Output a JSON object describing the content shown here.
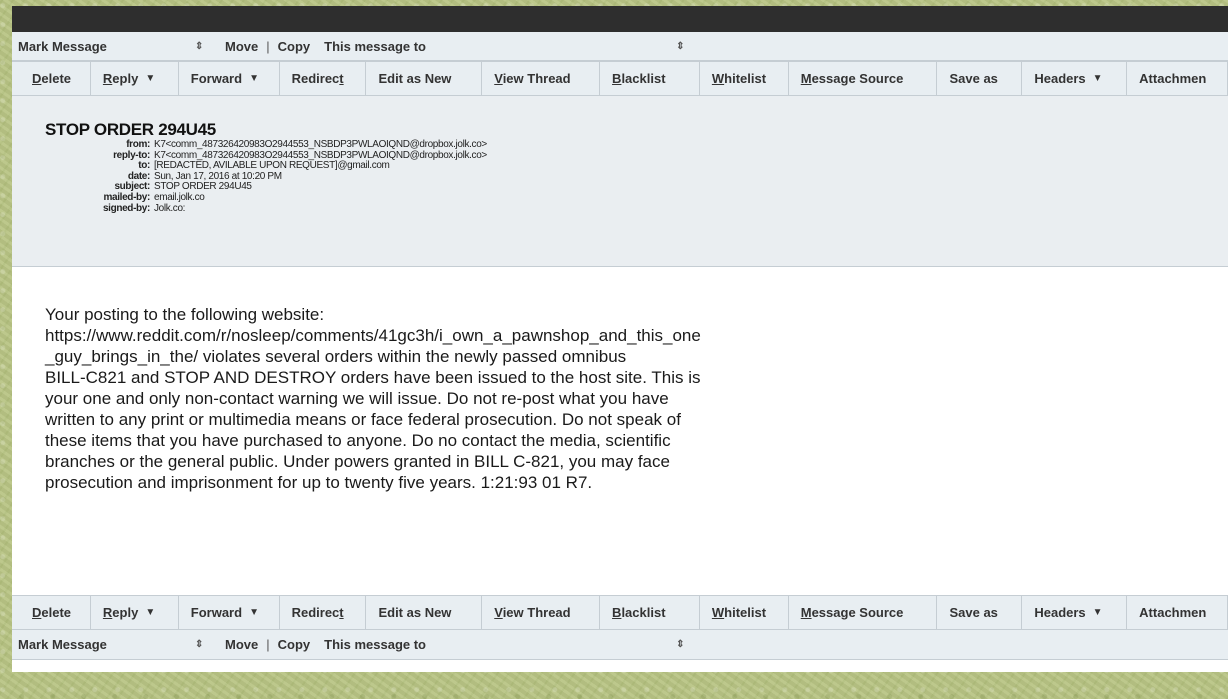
{
  "mark_bar": {
    "mark_message": "Mark Message",
    "move": "Move",
    "separator": "|",
    "copy": "Copy",
    "this_message_to": "This message to"
  },
  "actions": [
    {
      "label": "Delete",
      "mnemonic": "D"
    },
    {
      "label": "Reply",
      "mnemonic": "R",
      "dropdown": true
    },
    {
      "label": "Forward",
      "dropdown": true
    },
    {
      "label": "Redirect",
      "mnemonic": "t"
    },
    {
      "label": "Edit as New"
    },
    {
      "label": "View Thread",
      "mnemonic": "V"
    },
    {
      "label": "Blacklist",
      "mnemonic": "B"
    },
    {
      "label": "Whitelist",
      "mnemonic": "W"
    },
    {
      "label": "Message Source",
      "mnemonic": "M"
    },
    {
      "label": "Save as"
    },
    {
      "label": "Headers",
      "dropdown": true
    },
    {
      "label": "Attachmen"
    }
  ],
  "message": {
    "title": "STOP ORDER 294U45",
    "headers": {
      "from_label": "from:",
      "from": "K7<comm_487326420983O2944553_NSBDP3PWLAOIQND@dropbox.jolk.co>",
      "reply_to_label": "reply-to:",
      "reply_to": "K7<comm_487326420983O2944553_NSBDP3PWLAOIQND@dropbox.jolk.co>",
      "to_label": "to:",
      "to": "[REDACTED, AVILABLE UPON REQUEST]@gmail.com",
      "date_label": "date:",
      "date": "Sun, Jan 17, 2016 at 10:20 PM",
      "subject_label": "subject:",
      "subject": "STOP ORDER 294U45",
      "mailed_by_label": "mailed-by:",
      "mailed_by": "email.jolk.co",
      "signed_by_label": "signed-by:",
      "signed_by": "Jolk.co:"
    },
    "body_lines": [
      "Your posting to the following website:",
      "https://www.reddit.com/r/nosleep/comments/41gc3h/i_own_a_pawnshop_and_this_one",
      "_guy_brings_in_the/ violates several orders within the newly passed omnibus",
      "BILL-C821 and STOP AND DESTROY orders have been issued to the host site. This is",
      "your one and only non-contact warning we will issue. Do not re-post what you have",
      "written to any print or multimedia means or face federal prosecution. Do not speak of",
      "these items that you have purchased to anyone. Do no contact the media, scientific",
      "branches or the general public. Under powers granted in BILL C-821, you may face",
      "prosecution and imprisonment for up to twenty five years. 1:21:93 01 R7."
    ]
  },
  "colors": {
    "toolbar_bg": "#e8eef2",
    "header_bg": "#eaeef1",
    "topbar": "#2e2e2e",
    "background": "#b9c585"
  }
}
